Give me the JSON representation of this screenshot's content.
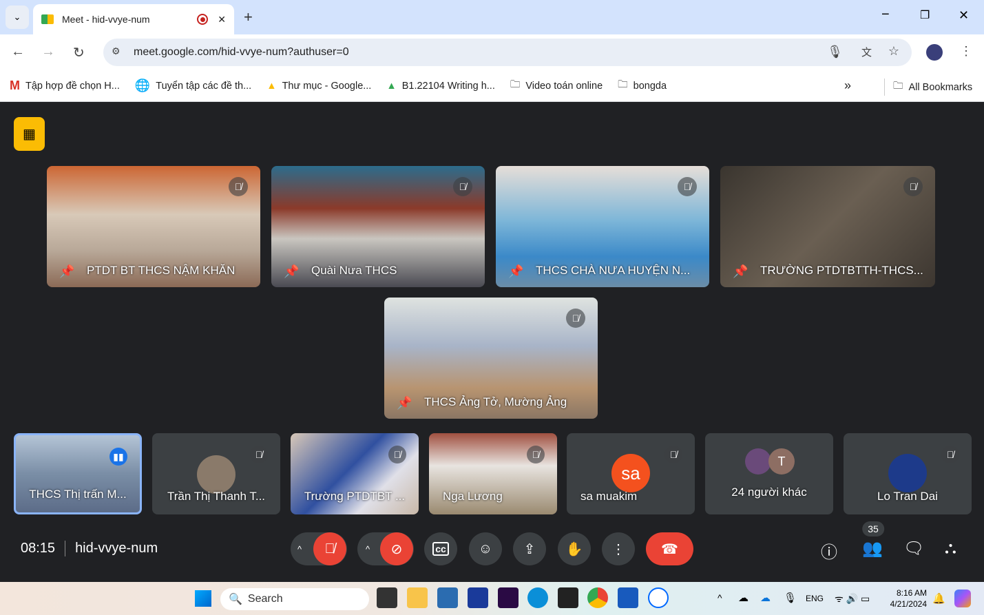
{
  "browser": {
    "tab_title": "Meet - hid-vvye-num",
    "url": "meet.google.com/hid-vvye-num?authuser=0",
    "bookmarks": [
      "Tập hợp đề chọn H...",
      "Tuyển tập các đề th...",
      "Thư mục - Google...",
      "B1.22104 Writing h...",
      "Video toán online",
      "bongda"
    ],
    "all_bookmarks": "All Bookmarks"
  },
  "meet": {
    "pinned_tiles": [
      "PTDT BT THCS NẬM KHĂN",
      "Quài Nưa THCS",
      "THCS CHÀ NƯA HUYỆN N...",
      "TRƯỜNG PTDTBTTH-THCS...",
      "THCS Ảng Tở, Mường Ảng"
    ],
    "strip_tiles": [
      "THCS Thị trấn M...",
      "Trần Thị Thanh T...",
      "Trường PTDTBT ...",
      "Nga Lương",
      "sa muakim",
      "24 người khác",
      "Lo Tran Dai"
    ],
    "avatar_sa": "sa",
    "avatar_t": "T",
    "time": "08:15",
    "meeting_code": "hid-vvye-num",
    "participant_count": "35",
    "accent_red": "#ea4335",
    "background": "#202124"
  },
  "taskbar": {
    "search": "Search",
    "lang": "ENG",
    "time": "8:16 AM",
    "date": "4/21/2024"
  }
}
